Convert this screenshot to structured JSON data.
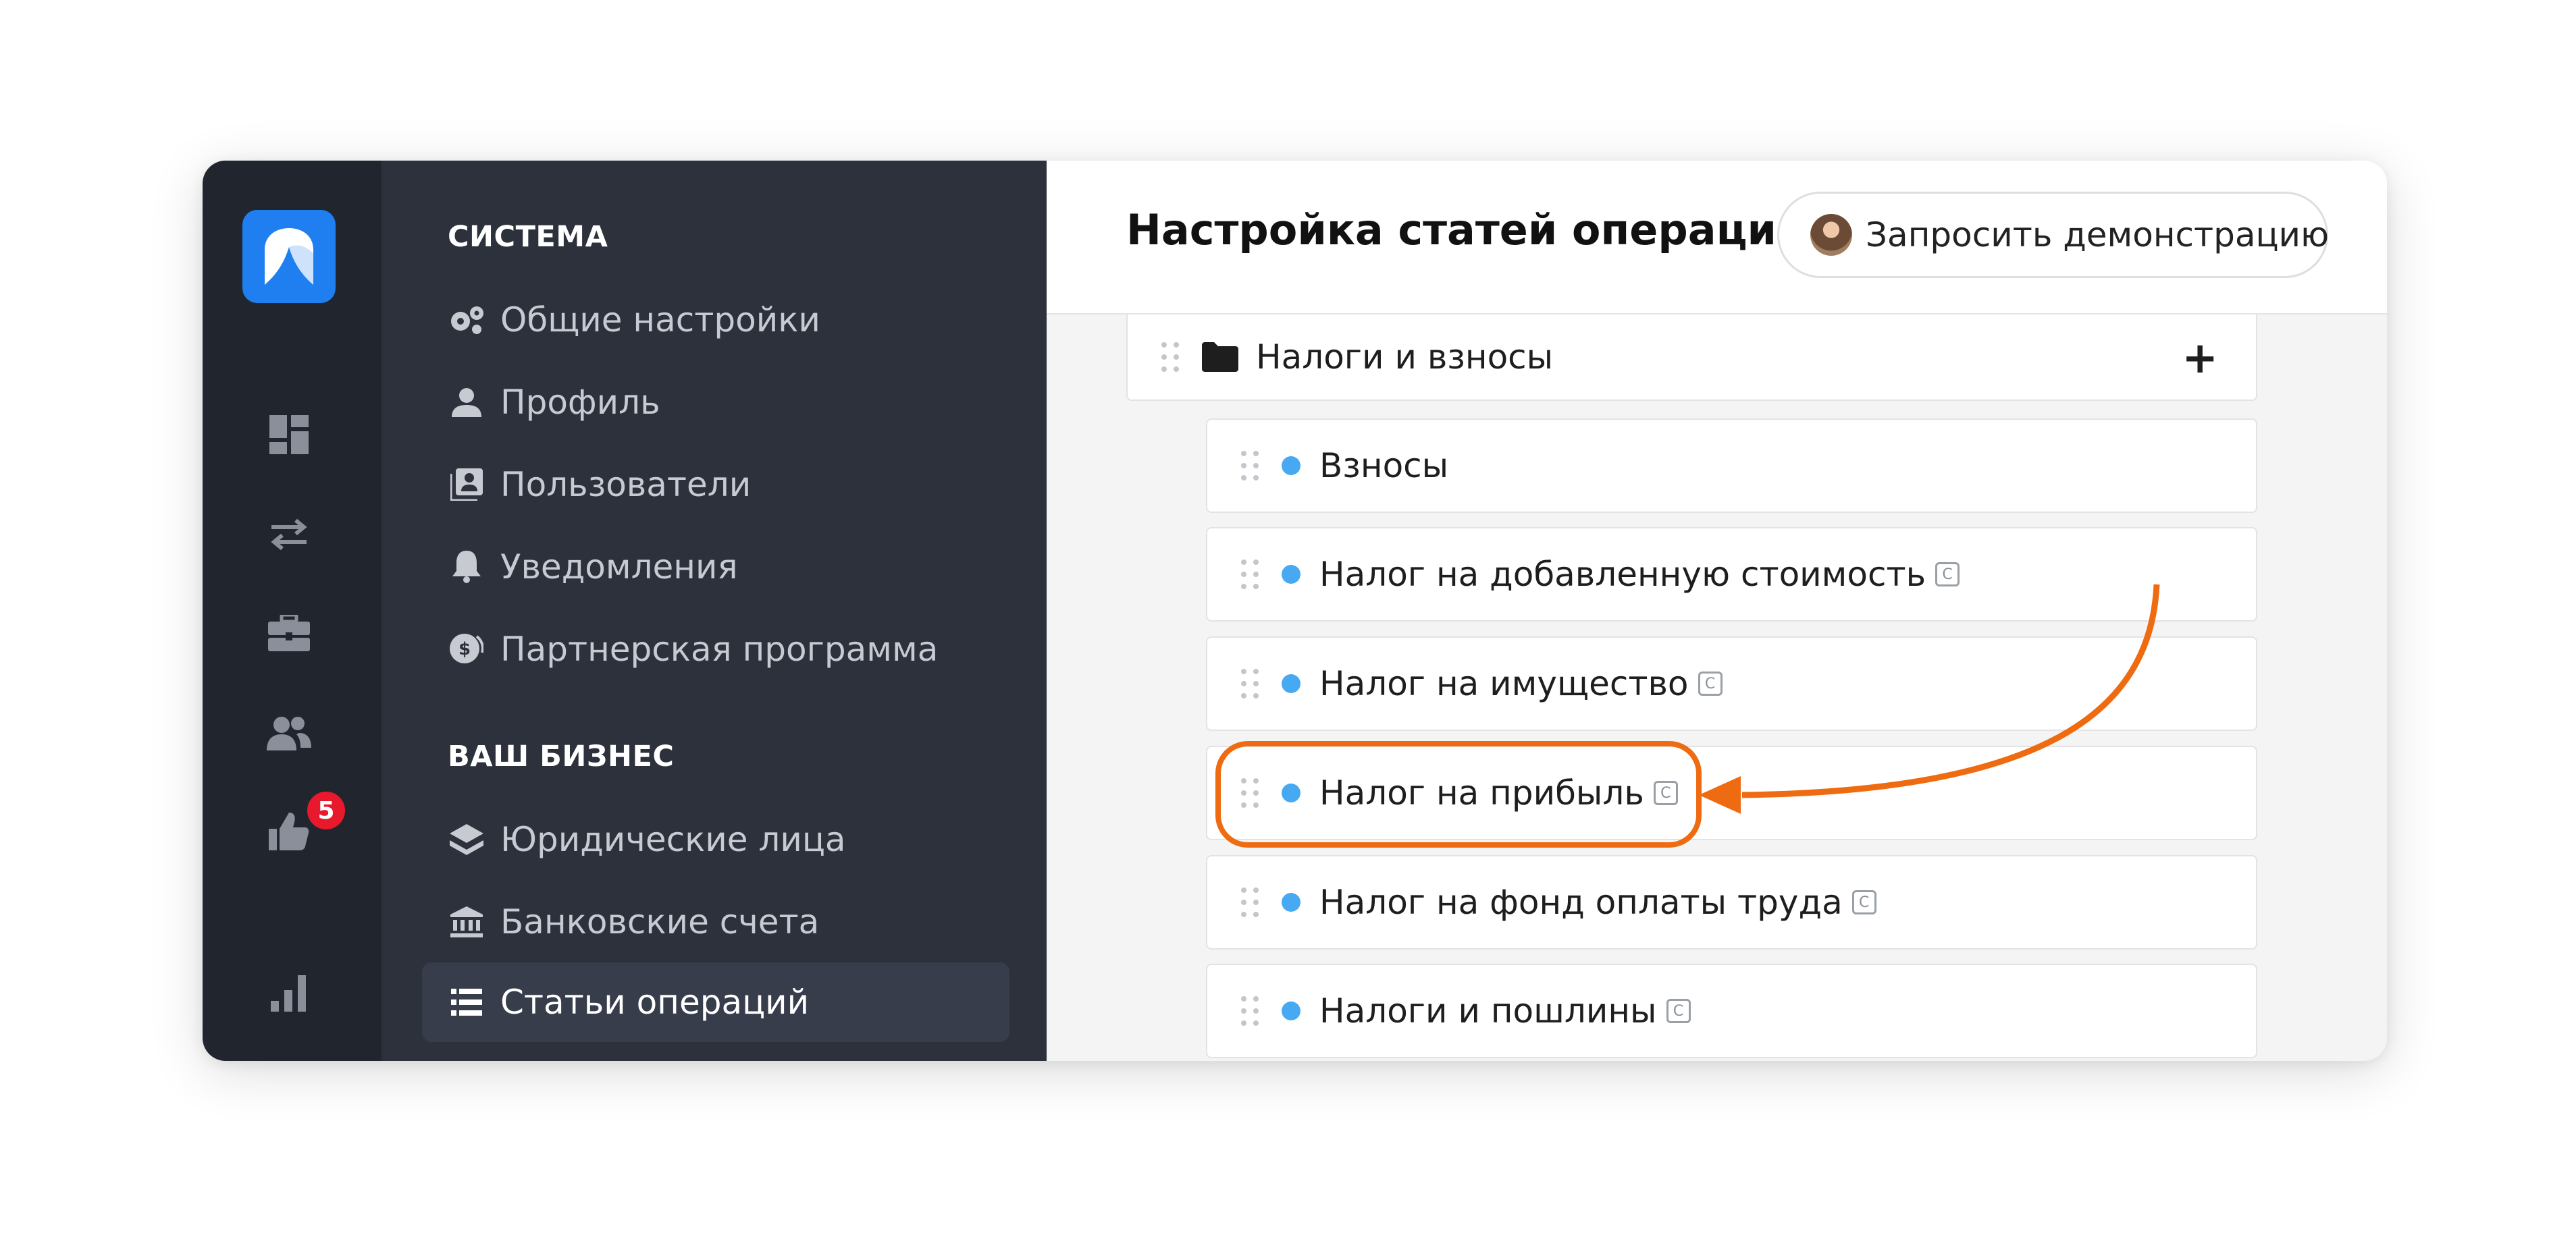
{
  "rail": {
    "badge_count": "5",
    "accent": "#1f7ff1",
    "badge_color": "#e8192c"
  },
  "sidebar": {
    "section_system": "СИСТЕМА",
    "system_items": [
      {
        "label": "Общие настройки",
        "icon": "gears-icon"
      },
      {
        "label": "Профиль",
        "icon": "user-icon"
      },
      {
        "label": "Пользователи",
        "icon": "users-card-icon"
      },
      {
        "label": "Уведомления",
        "icon": "bell-icon"
      },
      {
        "label": "Партнерская программа",
        "icon": "dollar-coin-icon"
      }
    ],
    "section_business": "ВАШ БИЗНЕС",
    "business_items": [
      {
        "label": "Юридические лица",
        "icon": "layers-icon"
      },
      {
        "label": "Банковские счета",
        "icon": "bank-icon"
      },
      {
        "label": "Статьи операций",
        "icon": "list-icon",
        "active": true
      }
    ]
  },
  "header": {
    "title": "Настройка статей операций",
    "demo_button": "Запросить демонстрацию"
  },
  "categories": {
    "folder": "Налоги и взносы",
    "items": [
      {
        "label": "Взносы",
        "system": false
      },
      {
        "label": "Налог на добавленную стоимость",
        "system": true
      },
      {
        "label": "Налог на имущество",
        "system": true
      },
      {
        "label": "Налог на прибыль",
        "system": true,
        "highlighted": true
      },
      {
        "label": "Налог на фонд оплаты труда",
        "system": true
      },
      {
        "label": "Налоги и пошлины",
        "system": true
      }
    ],
    "system_mark": "C",
    "dot_color": "#47a9f2",
    "highlight_color": "#ef6b12"
  }
}
